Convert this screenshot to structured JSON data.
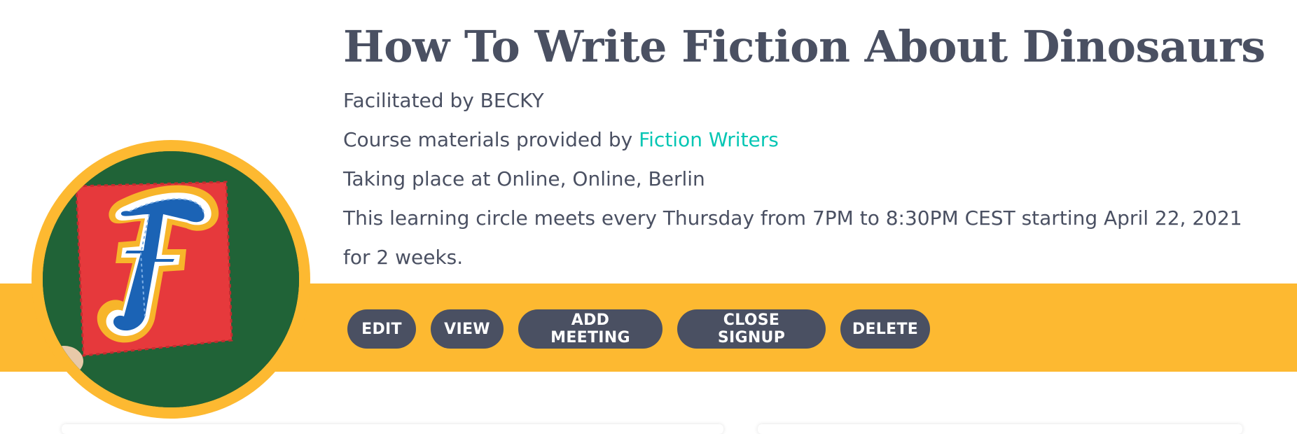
{
  "course": {
    "title": "How To Write Fiction About Dinosaurs",
    "facilitated_by": "Facilitated by BECKY",
    "materials_prefix": "Course materials provided by ",
    "materials_provider": "Fiction Writers",
    "location": "Taking place at Online, Online, Berlin",
    "schedule": "This learning circle meets every Thursday from 7PM to 8:30PM CEST starting April 22, 2021 for 2 weeks."
  },
  "actions": {
    "edit": "EDIT",
    "view": "VIEW",
    "add_meeting": "ADD MEETING",
    "close_signup": "CLOSE SIGNUP",
    "delete": "DELETE"
  },
  "colors": {
    "accent_band": "#fdb931",
    "text": "#4a5062",
    "link": "#05c6b4",
    "button_bg": "#4a5062"
  },
  "avatar": {
    "icon": "felt-letter-f-patch"
  }
}
